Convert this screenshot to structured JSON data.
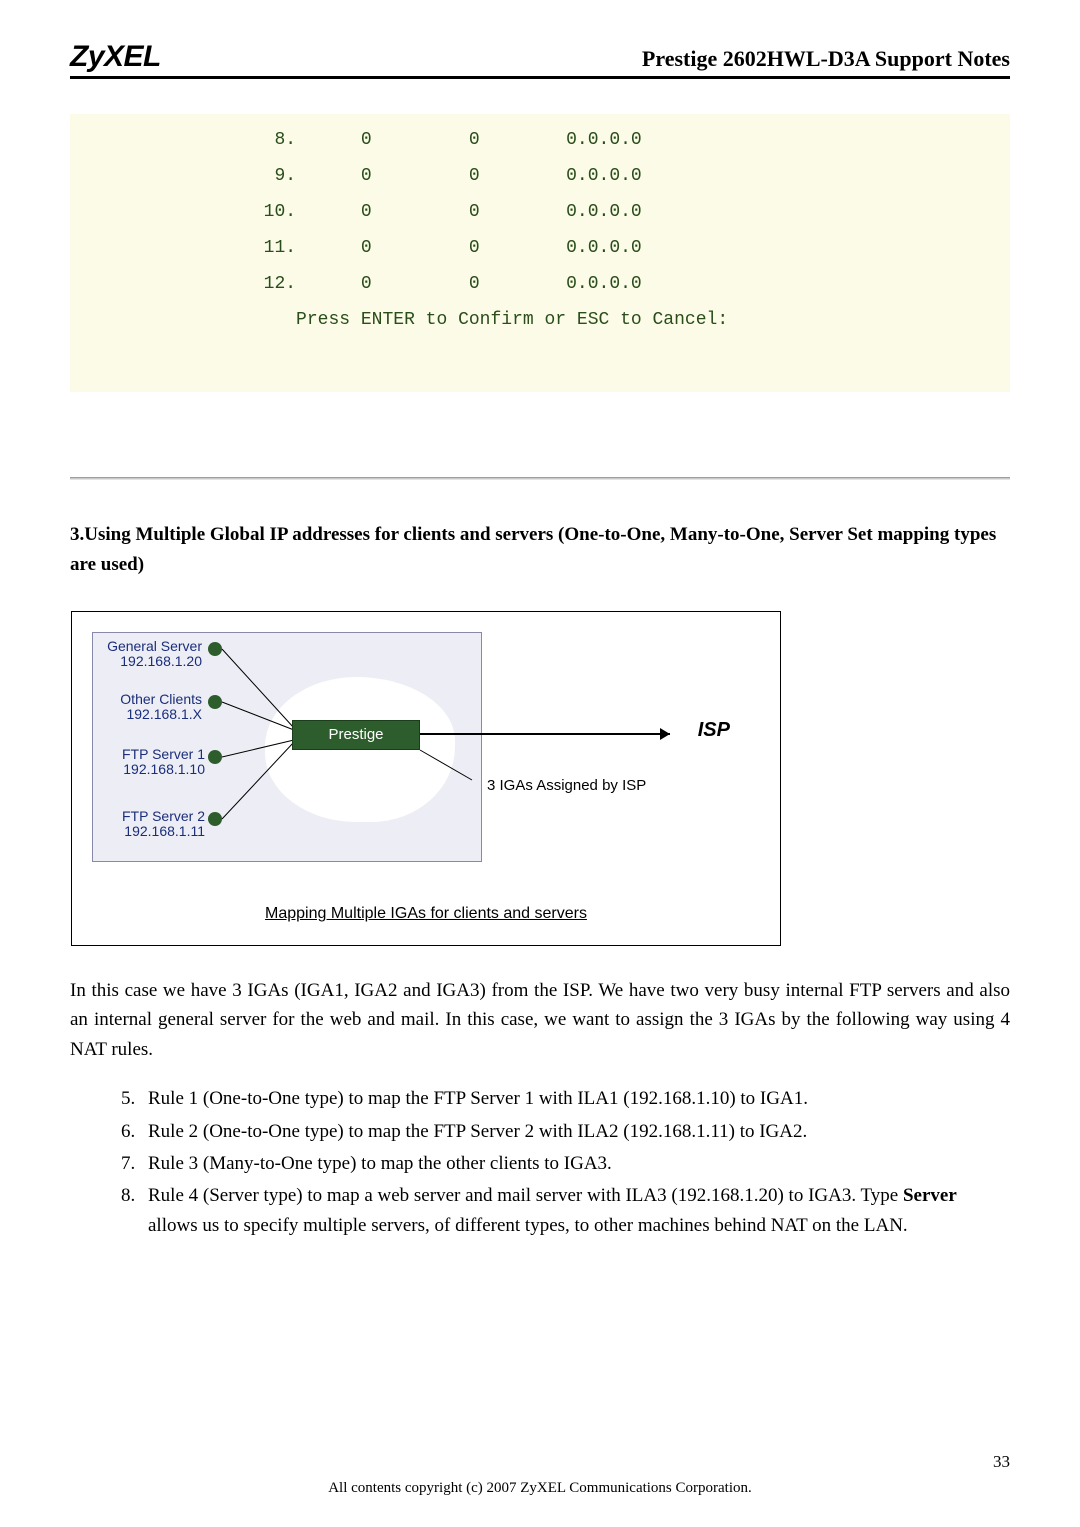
{
  "header": {
    "brand": "ZyXEL",
    "title": "Prestige 2602HWL-D3A Support Notes"
  },
  "code": {
    "rows": [
      {
        "idx": "8.",
        "c1": "0",
        "c2": "0",
        "c3": "0.0.0.0"
      },
      {
        "idx": "9.",
        "c1": "0",
        "c2": "0",
        "c3": "0.0.0.0"
      },
      {
        "idx": "10.",
        "c1": "0",
        "c2": "0",
        "c3": "0.0.0.0"
      },
      {
        "idx": "11.",
        "c1": "0",
        "c2": "0",
        "c3": "0.0.0.0"
      },
      {
        "idx": "12.",
        "c1": "0",
        "c2": "0",
        "c3": "0.0.0.0"
      }
    ],
    "footer": "Press ENTER to Confirm or ESC to Cancel:"
  },
  "section": {
    "heading": "3.Using Multiple Global IP addresses for clients and servers (One-to-One, Many-to-One, Server Set mapping types are used)"
  },
  "diagram": {
    "clients": [
      {
        "name": "General Server",
        "ip": "192.168.1.20"
      },
      {
        "name": "Other Clients",
        "ip": "192.168.1.X"
      },
      {
        "name": "FTP Server 1",
        "ip": "192.168.1.10"
      },
      {
        "name": "FTP Server 2",
        "ip": "192.168.1.11"
      }
    ],
    "router": "Prestige",
    "isp": "ISP",
    "iga_note": "3 IGAs Assigned by ISP",
    "caption": "Mapping Multiple IGAs for clients and servers"
  },
  "paragraph": "In this case we have 3 IGAs (IGA1, IGA2 and IGA3) from the ISP. We have two very busy internal FTP servers and also an internal general server for the web and mail. In this case, we want to assign the 3 IGAs by the following way using 4 NAT rules.",
  "rules": {
    "start": 5,
    "items": [
      "Rule 1 (One-to-One type) to map the FTP Server 1 with ILA1 (192.168.1.10) to IGA1.",
      "Rule 2 (One-to-One type) to map the FTP Server 2 with ILA2 (192.168.1.11) to IGA2.",
      "Rule 3 (Many-to-One type) to map the other clients to IGA3.",
      {
        "pre": "Rule 4 (Server type) to map a web server and mail server with ILA3 (192.168.1.20) to IGA3. Type ",
        "bold": "Server",
        "post": " allows us to specify multiple servers, of different types, to other machines behind NAT on the LAN."
      }
    ]
  },
  "footer": {
    "page": "33",
    "copyright": "All contents copyright (c) 2007 ZyXEL Communications Corporation."
  }
}
